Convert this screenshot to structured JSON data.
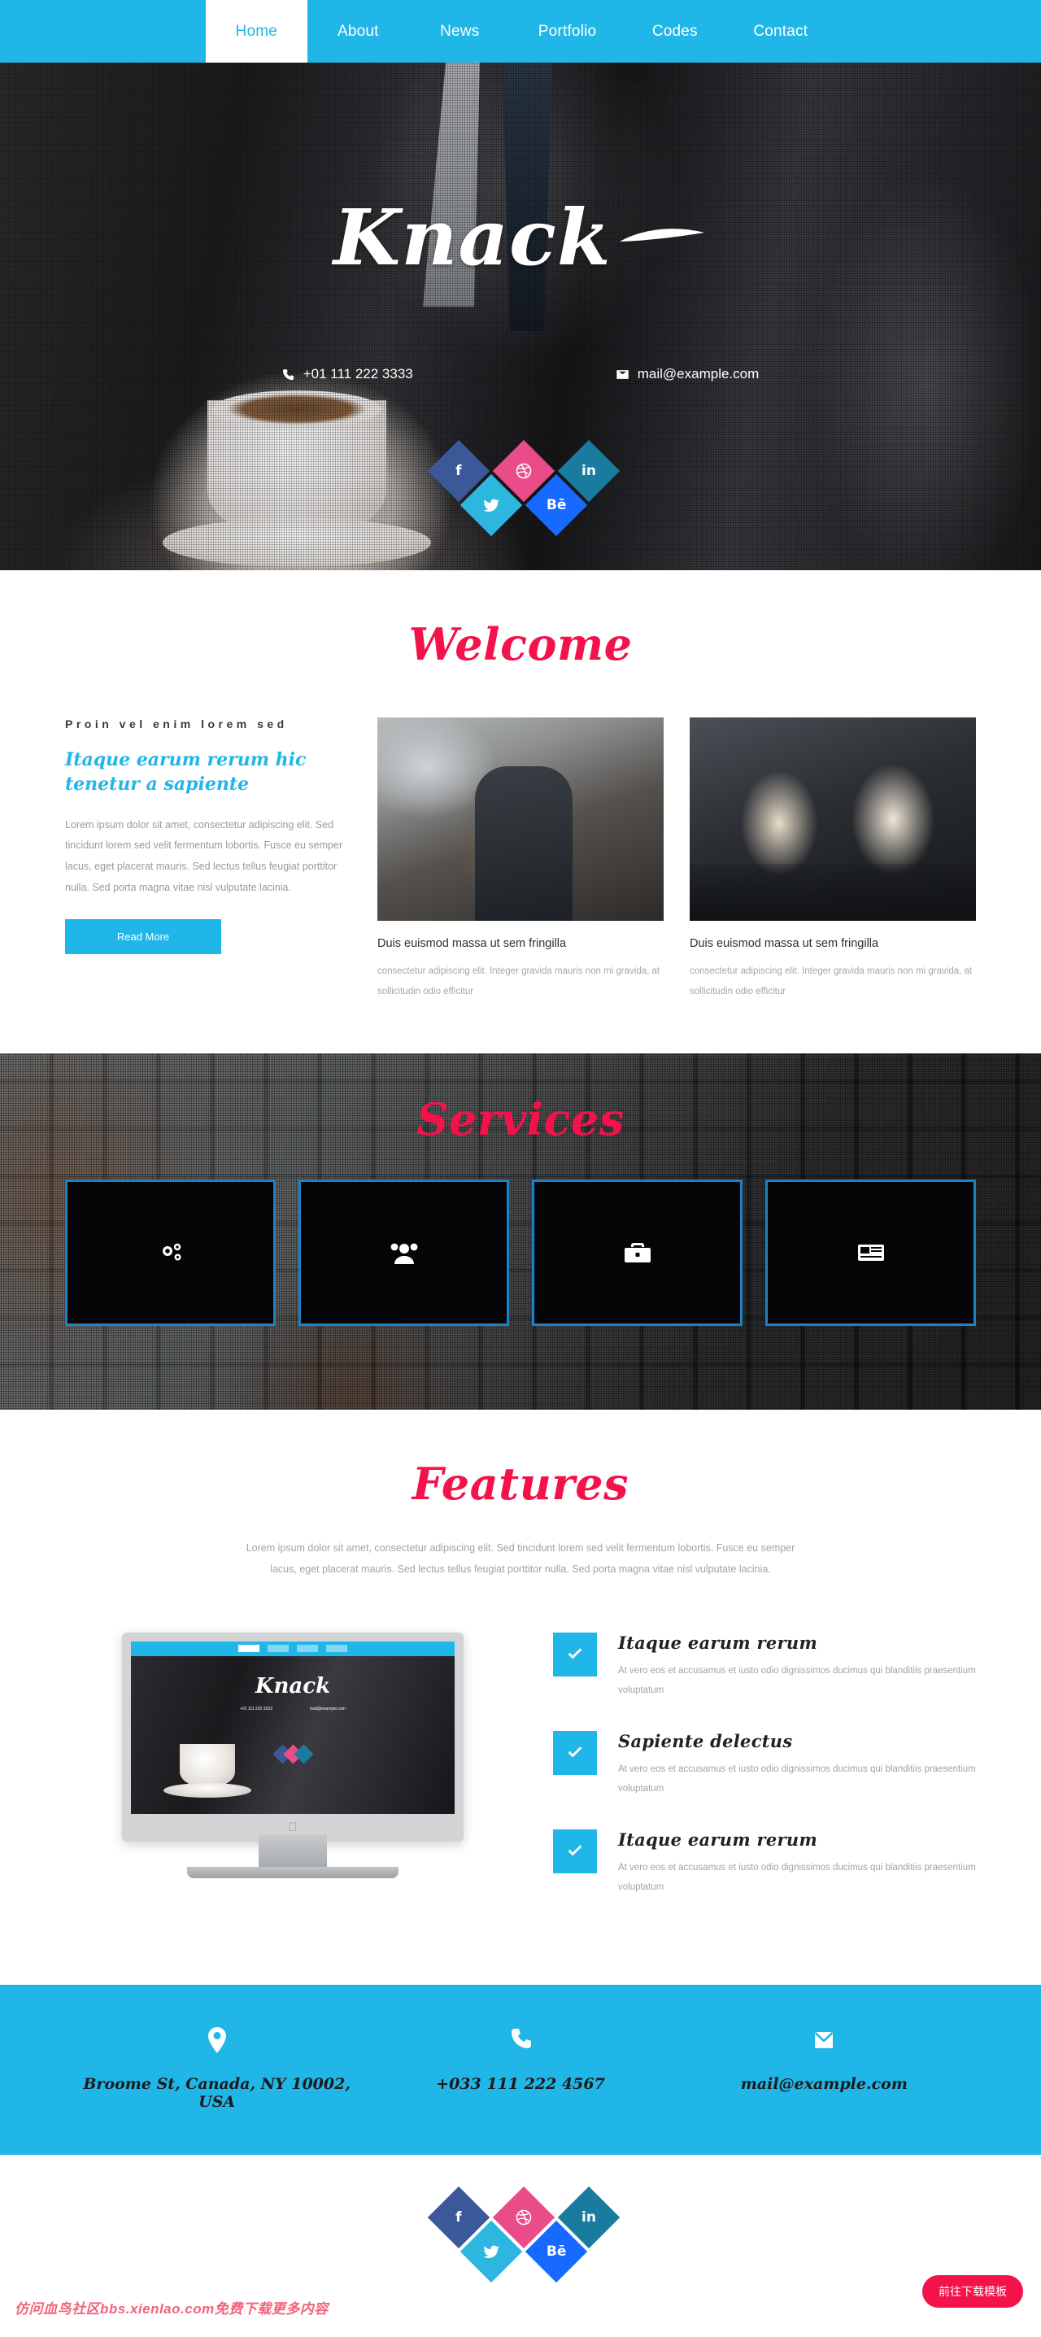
{
  "nav": {
    "items": [
      {
        "label": "Home",
        "active": true
      },
      {
        "label": "About",
        "active": false
      },
      {
        "label": "News",
        "active": false
      },
      {
        "label": "Portfolio",
        "active": false
      },
      {
        "label": "Codes",
        "active": false
      },
      {
        "label": "Contact",
        "active": false
      }
    ]
  },
  "hero": {
    "logo": "Knack",
    "phone": "+01 111 222 3333",
    "email": "mail@example.com",
    "socials": [
      {
        "name": "facebook",
        "glyph": "f",
        "color": "#3b5998"
      },
      {
        "name": "twitter",
        "glyph": "t",
        "color": "#2cb6e0"
      },
      {
        "name": "dribbble",
        "glyph": "d",
        "color": "#ea4c89"
      },
      {
        "name": "behance",
        "glyph": "Bē",
        "color": "#1769ff"
      },
      {
        "name": "linkedin",
        "glyph": "in",
        "color": "#1b7b9e"
      }
    ]
  },
  "welcome": {
    "title": "Welcome",
    "eyebrow": "Proin vel enim lorem sed",
    "subhead": "Itaque earum rerum hic tenetur a sapiente",
    "body": "Lorem ipsum dolor sit amet, consectetur adipiscing elit. Sed tincidunt lorem sed velit fermentum lobortis. Fusce eu semper lacus, eget placerat mauris. Sed lectus tellus feugiat porttitor nulla. Sed porta magna vitae nisl vulputate lacinia.",
    "button": "Read More",
    "cards": [
      {
        "caption": "Duis euismod massa ut sem fringilla",
        "body": "consectetur adipiscing elit. Integer gravida mauris non mi gravida, at sollicitudin odio efficitur"
      },
      {
        "caption": "Duis euismod massa ut sem fringilla",
        "body": "consectetur adipiscing elit. Integer gravida mauris non mi gravida, at sollicitudin odio efficitur"
      }
    ]
  },
  "services": {
    "title": "Services",
    "boxes": [
      {
        "icon": "gears-icon"
      },
      {
        "icon": "users-icon"
      },
      {
        "icon": "briefcase-icon"
      },
      {
        "icon": "list-icon"
      }
    ]
  },
  "features": {
    "title": "Features",
    "intro": "Lorem ipsum dolor sit amet, consectetur adipiscing elit. Sed tincidunt lorem sed velit fermentum lobortis. Fusce eu semper lacus, eget placerat mauris. Sed lectus tellus feugiat porttitor nulla. Sed porta magna vitae nisl vulputate lacinia.",
    "mockup_logo": "Knack",
    "mockup_phone": "+01 111 222 3333",
    "mockup_email": "mail@example.com",
    "items": [
      {
        "heading": "Itaque earum rerum",
        "body": "At vero eos et accusamus et iusto odio dignissimos ducimus qui blanditiis praesentium voluptatum"
      },
      {
        "heading": "Sapiente delectus",
        "body": "At vero eos et accusamus et iusto odio dignissimos ducimus qui blanditiis praesentium voluptatum"
      },
      {
        "heading": "Itaque earum rerum",
        "body": "At vero eos et accusamus et iusto odio dignissimos ducimus qui blanditiis praesentium voluptatum"
      }
    ]
  },
  "footer": {
    "address": "Broome St, Canada, NY 10002, USA",
    "phone": "+033 111 222 4567",
    "email": "mail@example.com",
    "socials": [
      {
        "name": "facebook",
        "glyph": "f",
        "color": "#3b5998"
      },
      {
        "name": "twitter",
        "glyph": "t",
        "color": "#2cb6e0"
      },
      {
        "name": "dribbble",
        "glyph": "d",
        "color": "#ea4c89"
      },
      {
        "name": "behance",
        "glyph": "Bē",
        "color": "#1769ff"
      },
      {
        "name": "linkedin",
        "glyph": "in",
        "color": "#1b7b9e"
      }
    ],
    "watermark": "仿问血鸟社区bbs.xienlao.com免费下载更多内容",
    "download_button": "前往下载模板"
  },
  "colors": {
    "accent": "#21b6e8",
    "pink": "#f4124a",
    "dark": "#111111"
  }
}
